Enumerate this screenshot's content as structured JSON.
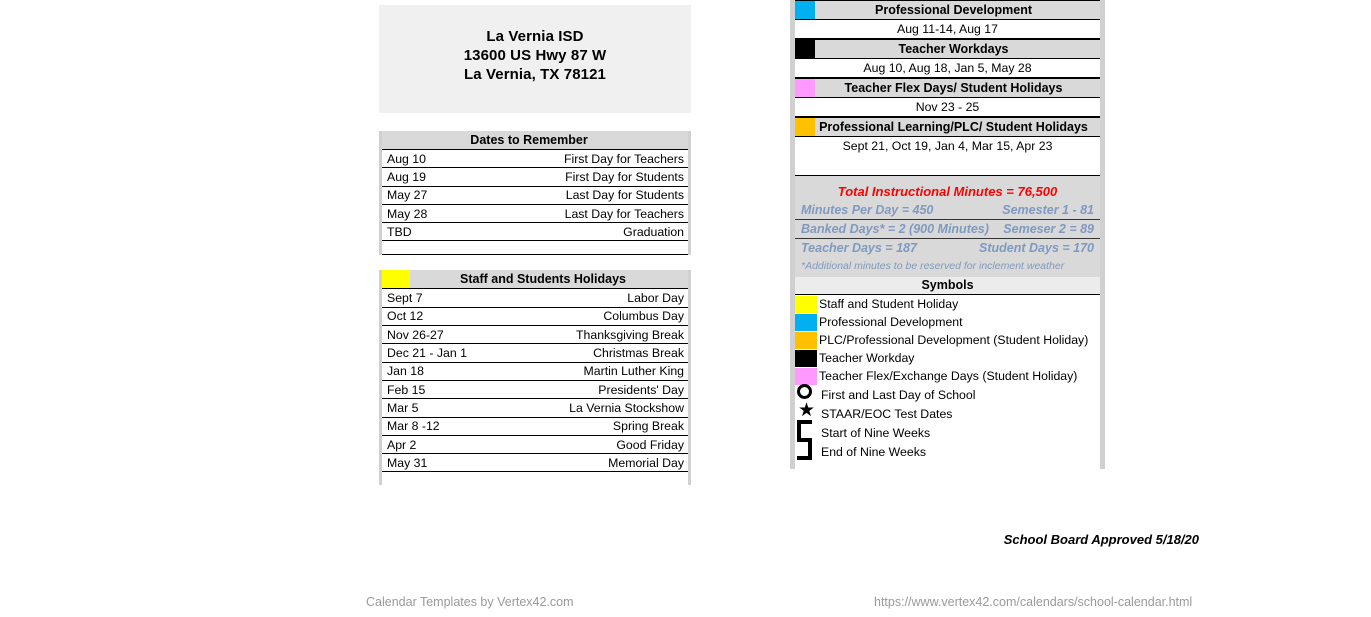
{
  "district": {
    "name": "La Vernia ISD",
    "address": "13600 US Hwy 87 W",
    "city_state_zip": "La Vernia, TX 78121"
  },
  "colors": {
    "staff_student_holiday": "#ffff00",
    "professional_development": "#00b0f0",
    "plc_student_holiday": "#ffc000",
    "teacher_workday": "#000000",
    "teacher_flex": "#ff99ff",
    "total_minutes_text": "#ff0000",
    "stats_text": "#8099c0",
    "header_band": "#d9d9d9",
    "panel_edge": "#d0d0d0"
  },
  "dates_to_remember": {
    "title": "Dates to Remember",
    "rows": [
      {
        "date": "Aug 10",
        "desc": "First Day for Teachers"
      },
      {
        "date": "Aug 19",
        "desc": "First Day for Students"
      },
      {
        "date": "May 27",
        "desc": "Last Day for Students"
      },
      {
        "date": "May 28",
        "desc": "Last Day for Teachers"
      },
      {
        "date": "TBD",
        "desc": "Graduation"
      }
    ]
  },
  "staff_student_holidays": {
    "title": "Staff and Students Holidays",
    "rows": [
      {
        "date": "Sept 7",
        "desc": "Labor Day"
      },
      {
        "date": "Oct 12",
        "desc": "Columbus Day"
      },
      {
        "date": "Nov 26-27",
        "desc": "Thanksgiving Break"
      },
      {
        "date": "Dec 21 - Jan 1",
        "desc": "Christmas Break"
      },
      {
        "date": "Jan 18",
        "desc": "Martin Luther King"
      },
      {
        "date": "Feb 15",
        "desc": "Presidents' Day"
      },
      {
        "date": "Mar 5",
        "desc": "La Vernia Stockshow"
      },
      {
        "date": "Mar 8 -12",
        "desc": "Spring Break"
      },
      {
        "date": "Apr 2",
        "desc": "Good Friday"
      },
      {
        "date": "May 31",
        "desc": "Memorial Day"
      }
    ]
  },
  "right_sections": [
    {
      "title": "Professional Development",
      "value": "Aug 11-14, Aug 17",
      "swatch": "#00b0f0"
    },
    {
      "title": "Teacher Workdays",
      "value": "Aug 10,  Aug 18, Jan 5, May 28",
      "swatch": "#000000"
    },
    {
      "title": "Teacher Flex Days/ Student Holidays",
      "value": "Nov 23 - 25",
      "swatch": "#ff99ff"
    },
    {
      "title": "Professional Learning/PLC/ Student Holidays",
      "value": "Sept 21, Oct 19, Jan 4, Mar 15, Apr 23",
      "swatch": "#ffc000"
    }
  ],
  "stats": {
    "title": "Total Instructional Minutes = 76,500",
    "row1_left": "Minutes Per Day = 450",
    "row1_right": "Semester 1 - 81",
    "row2_left": "Banked Days* = 2 (900 Minutes)",
    "row2_right": "Semeser 2 = 89",
    "row3_left": "Teacher Days = 187",
    "row3_right": "Student Days = 170",
    "note": "*Additional minutes to be reserved for inclement weather"
  },
  "symbols": {
    "title": "Symbols",
    "color_items": [
      {
        "label": "Staff and Student Holiday",
        "color": "#ffff00"
      },
      {
        "label": "Professional Development",
        "color": "#00b0f0"
      },
      {
        "label": "PLC/Professional Development (Student Holiday)",
        "color": "#ffc000"
      },
      {
        "label": "Teacher Workday",
        "color": "#000000"
      },
      {
        "label": "Teacher Flex/Exchange Days (Student Holiday)",
        "color": "#ff99ff"
      }
    ],
    "shape_items": [
      {
        "label": "First and Last Day of School",
        "glyph": "circle-outline-icon"
      },
      {
        "label": "STAAR/EOC Test Dates",
        "glyph": "star-icon"
      },
      {
        "label": "Start of Nine Weeks",
        "glyph": "bracket-start-icon"
      },
      {
        "label": "End of Nine Weeks",
        "glyph": "bracket-end-icon"
      }
    ]
  },
  "approval": "School Board Approved 5/18/20",
  "footer": {
    "left": "Calendar Templates by Vertex42.com",
    "right": "https://www.vertex42.com/calendars/school-calendar.html"
  }
}
